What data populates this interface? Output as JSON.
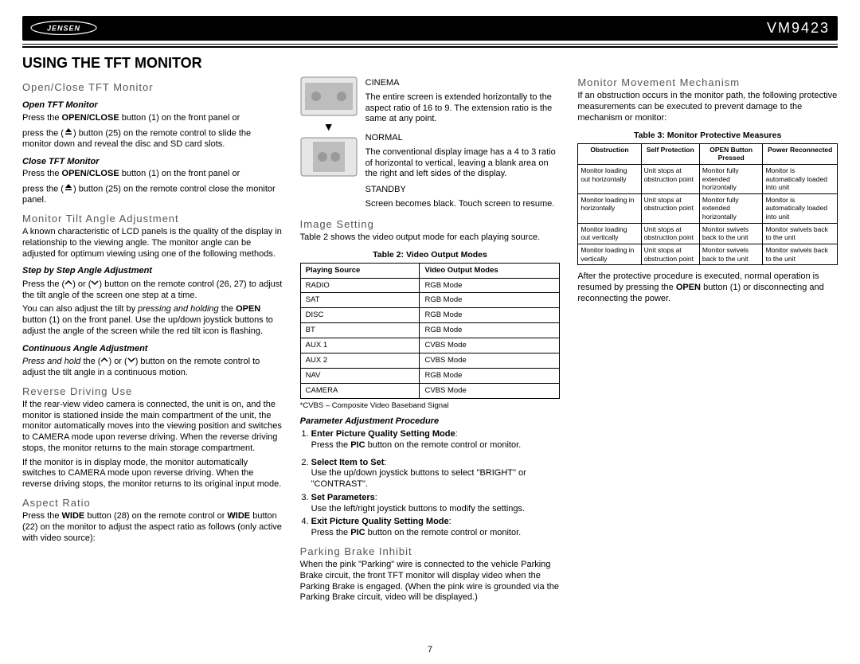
{
  "header": {
    "brand": "JENSEN",
    "model": "VM9423"
  },
  "page_number": "7",
  "section_title": "USING THE TFT MONITOR",
  "col1": {
    "h_openclose": "Open/Close TFT Monitor",
    "h_open": "Open TFT Monitor",
    "p_open_a": "Press the ",
    "p_open_b": "OPEN/CLOSE",
    "p_open_c": " button (1) on the front panel or",
    "p_open_d": "press the (",
    "p_open_e": ") button (25) on the remote control to slide the monitor down and reveal the disc and SD card slots.",
    "h_close": "Close TFT Monitor",
    "p_close_a": "Press the ",
    "p_close_b": "OPEN/CLOSE",
    "p_close_c": " button (1) on the front panel or",
    "p_close_d": "press the (",
    "p_close_e": ") button (25) on the remote control close the monitor panel.",
    "h_tilt": "Monitor Tilt Angle Adjustment",
    "p_tilt": "A known characteristic of LCD panels is the quality of the display in relationship to the viewing angle. The monitor angle can be adjusted for optimum viewing using one of the following methods.",
    "h_step": "Step by Step Angle Adjustment",
    "p_step_a": "Press the (",
    "p_step_b": ") or (",
    "p_step_c": ") button on the remote control (26, 27) to adjust the tilt angle of the screen one step at a time.",
    "p_step2_a": "You can also adjust the tilt by ",
    "p_step2_b": "pressing and holding",
    "p_step2_c": " the ",
    "p_step2_d": "OPEN",
    "p_step2_e": " button (1) on the front panel. Use the up/down joystick buttons to adjust the angle of the screen while the red tilt icon is flashing.",
    "h_cont": "Continuous Angle Adjustment",
    "p_cont_a": "Press and hold",
    "p_cont_b": " the (",
    "p_cont_c": ") or (",
    "p_cont_d": ") button on the remote control to adjust the tilt angle in a continuous motion.",
    "h_rev": "Reverse Driving Use",
    "p_rev1": "If the rear-view video camera is connected, the unit is on, and the monitor is stationed inside the main compartment of the unit, the monitor automatically moves into the viewing position and switches to CAMERA mode upon reverse driving. When the reverse driving stops, the monitor returns to the main storage compartment.",
    "p_rev2": "If the monitor is in display mode, the monitor automatically switches to CAMERA mode upon reverse driving. When the reverse driving stops, the monitor returns to its original input mode."
  },
  "col2": {
    "h_aspect": "Aspect Ratio",
    "p_aspect_a": "Press the ",
    "p_aspect_b": "WIDE",
    "p_aspect_c": " button (28) on the remote control or ",
    "p_aspect_d": "WIDE",
    "p_aspect_e": " button (22) on the monitor to adjust the aspect ratio as follows (only active with video source):",
    "cinema_h": "CINEMA",
    "cinema_p": "The entire screen is extended horizontally to the aspect ratio of 16 to 9. The extension ratio is the same at any point.",
    "normal_h": "NORMAL",
    "normal_p": "The conventional display image has a 4 to 3 ratio of horizontal to vertical, leaving a blank area on the right and left sides of the display.",
    "standby_h": "STANDBY",
    "standby_p": "Screen becomes black. Touch screen to resume.",
    "h_image": "Image Setting",
    "p_image": "Table 2 shows the video output mode for each playing source.",
    "t2_title": "Table 2: Video Output Modes",
    "t2_h1": "Playing Source",
    "t2_h2": "Video Output Modes",
    "t2_rows": [
      {
        "s": "RADIO",
        "m": "RGB Mode"
      },
      {
        "s": "SAT",
        "m": "RGB Mode"
      },
      {
        "s": "DISC",
        "m": "RGB Mode"
      },
      {
        "s": "BT",
        "m": "RGB Mode"
      },
      {
        "s": "AUX 1",
        "m": "CVBS Mode"
      },
      {
        "s": "AUX 2",
        "m": "CVBS Mode"
      },
      {
        "s": "NAV",
        "m": "RGB Mode"
      },
      {
        "s": "CAMERA",
        "m": "CVBS Mode"
      }
    ],
    "t2_note": "*CVBS – Composite Video Baseband Signal",
    "h_param": "Parameter Adjustment Procedure",
    "step1_a": "Enter Picture Quality Setting Mode",
    "step1_b": "Press the ",
    "step1_c": "PIC",
    "step1_d": " button on the remote control or monitor."
  },
  "col3": {
    "step2_a": "Select Item to Set",
    "step2_b": "Use the up/down joystick buttons to select \"BRIGHT\" or \"CONTRAST\".",
    "step3_a": "Set Parameters",
    "step3_b": "Use the left/right joystick buttons to modify the settings.",
    "step4_a": "Exit Picture Quality Setting Mode",
    "step4_b": "Press the ",
    "step4_c": "PIC",
    "step4_d": " button on the remote control or monitor.",
    "h_parking": "Parking Brake Inhibit",
    "p_parking": "When the pink \"Parking\" wire is connected to the vehicle Parking Brake circuit, the front TFT monitor will display video when the Parking Brake is engaged. (When the pink wire is grounded via the Parking Brake circuit, video will be displayed.)",
    "h_move": "Monitor Movement Mechanism",
    "p_move": "If an obstruction occurs in the monitor path, the following protective measurements can be executed to prevent damage to the mechanism or monitor:",
    "t3_title": "Table 3: Monitor Protective Measures",
    "t3_h1": "Obstruction",
    "t3_h2": "Self Protection",
    "t3_h3": "OPEN Button Pressed",
    "t3_h4": "Power Reconnected",
    "t3_rows": [
      {
        "a": "Monitor loading out horizontally",
        "b": "Unit stops at obstruction point",
        "c": "Monitor fully extended horizontally",
        "d": "Monitor is automatically loaded into unit"
      },
      {
        "a": "Monitor loading in horizontally",
        "b": "Unit stops at obstruction point",
        "c": "Monitor fully extended horizontally",
        "d": "Monitor is automatically loaded into unit"
      },
      {
        "a": "Monitor loading out vertically",
        "b": "Unit stops at obstruction point",
        "c": "Monitor swivels back to the unit",
        "d": "Monitor swivels back to the unit"
      },
      {
        "a": "Monitor loading in vertically",
        "b": "Unit stops at obstruction point",
        "c": "Monitor swivels back to the unit",
        "d": "Monitor swivels back to the unit"
      }
    ],
    "p_after_a": "After the protective procedure is executed, normal operation is resumed by pressing the ",
    "p_after_b": "OPEN",
    "p_after_c": " button (1) or disconnecting and reconnecting the power."
  }
}
